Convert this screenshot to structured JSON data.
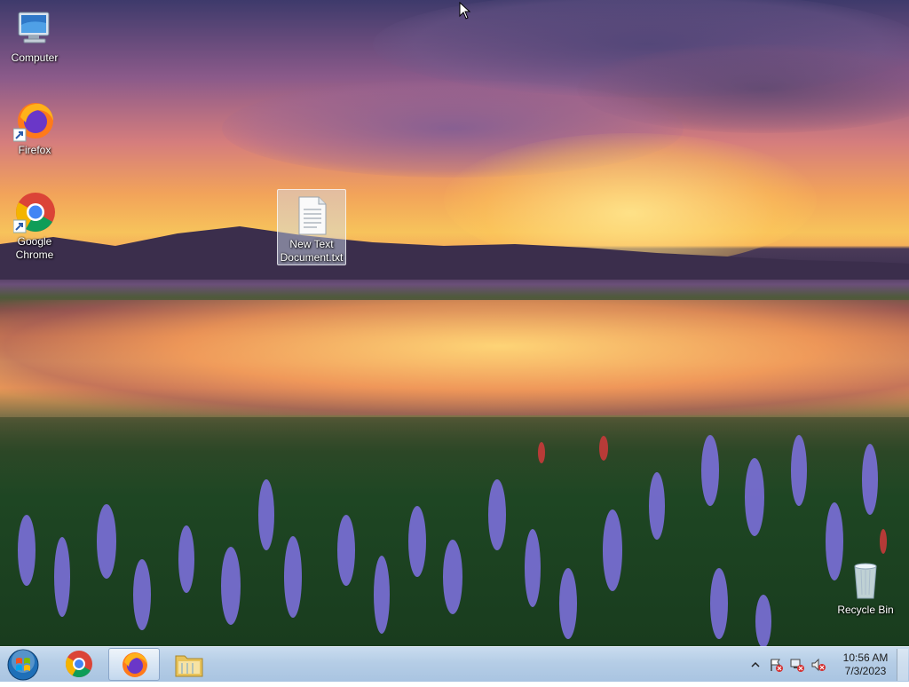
{
  "desktop": {
    "icons": [
      {
        "label": "Computer",
        "icon": "computer-icon"
      },
      {
        "label": "Firefox",
        "icon": "firefox-icon"
      },
      {
        "label": "Google Chrome",
        "label_line1": "Google",
        "label_line2": "Chrome",
        "icon": "chrome-icon"
      },
      {
        "label": "New Text Document.txt",
        "label_line1": "New Text",
        "label_line2": "Document.txt",
        "icon": "text-file-icon"
      },
      {
        "label": "Recycle Bin",
        "icon": "recycle-bin-icon"
      }
    ]
  },
  "taskbar": {
    "start": "start-button",
    "pinned": [
      {
        "name": "chrome",
        "icon": "chrome-icon"
      },
      {
        "name": "firefox",
        "icon": "firefox-icon",
        "active": true
      },
      {
        "name": "file-explorer",
        "icon": "folder-icon"
      }
    ],
    "tray": {
      "time": "10:56 AM",
      "date": "7/3/2023"
    }
  },
  "colors": {
    "taskbar": "#b5cde6",
    "icon_text": "#ffffff"
  }
}
